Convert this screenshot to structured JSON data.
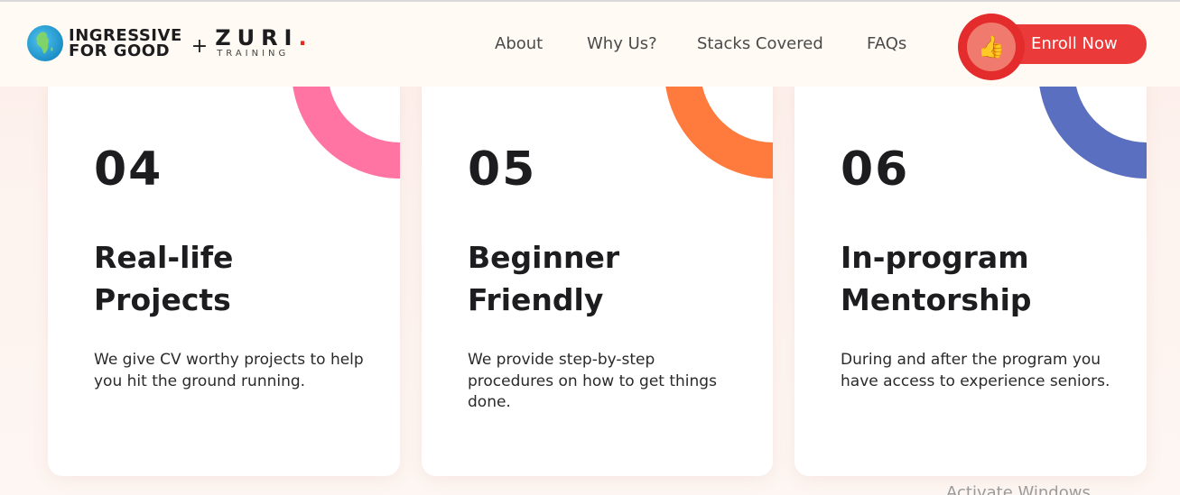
{
  "header": {
    "brand": {
      "ingressive_line1": "INGRESSIVE",
      "ingressive_line2": "FOR GOOD",
      "plus": "+",
      "zuri_main": "ZURI",
      "zuri_dot": ".",
      "zuri_sub": "TRAINING",
      "zuri_dot_color": "#e02b20"
    },
    "nav": [
      {
        "label": "About"
      },
      {
        "label": "Why Us?"
      },
      {
        "label": "Stacks Covered"
      },
      {
        "label": "FAQs"
      }
    ],
    "enroll": {
      "label": "Enroll Now",
      "icon": "thumbs-up-icon",
      "emoji": "👍",
      "color": "#ea3a3a"
    }
  },
  "cards": [
    {
      "number": "04",
      "title_line1": "Real-life",
      "title_line2": "Projects",
      "desc": "We give CV worthy projects to help you hit the ground running.",
      "accent": "#ff74a2"
    },
    {
      "number": "05",
      "title_line1": "Beginner",
      "title_line2": "Friendly",
      "desc": "We provide step-by-step procedures on how to get things done.",
      "accent": "#ff7b3d"
    },
    {
      "number": "06",
      "title_line1": "In-program",
      "title_line2": "Mentorship",
      "desc": "During and after the program you have access to experience seniors.",
      "accent": "#5a6fbf"
    }
  ],
  "watermark": "Activate Windows"
}
